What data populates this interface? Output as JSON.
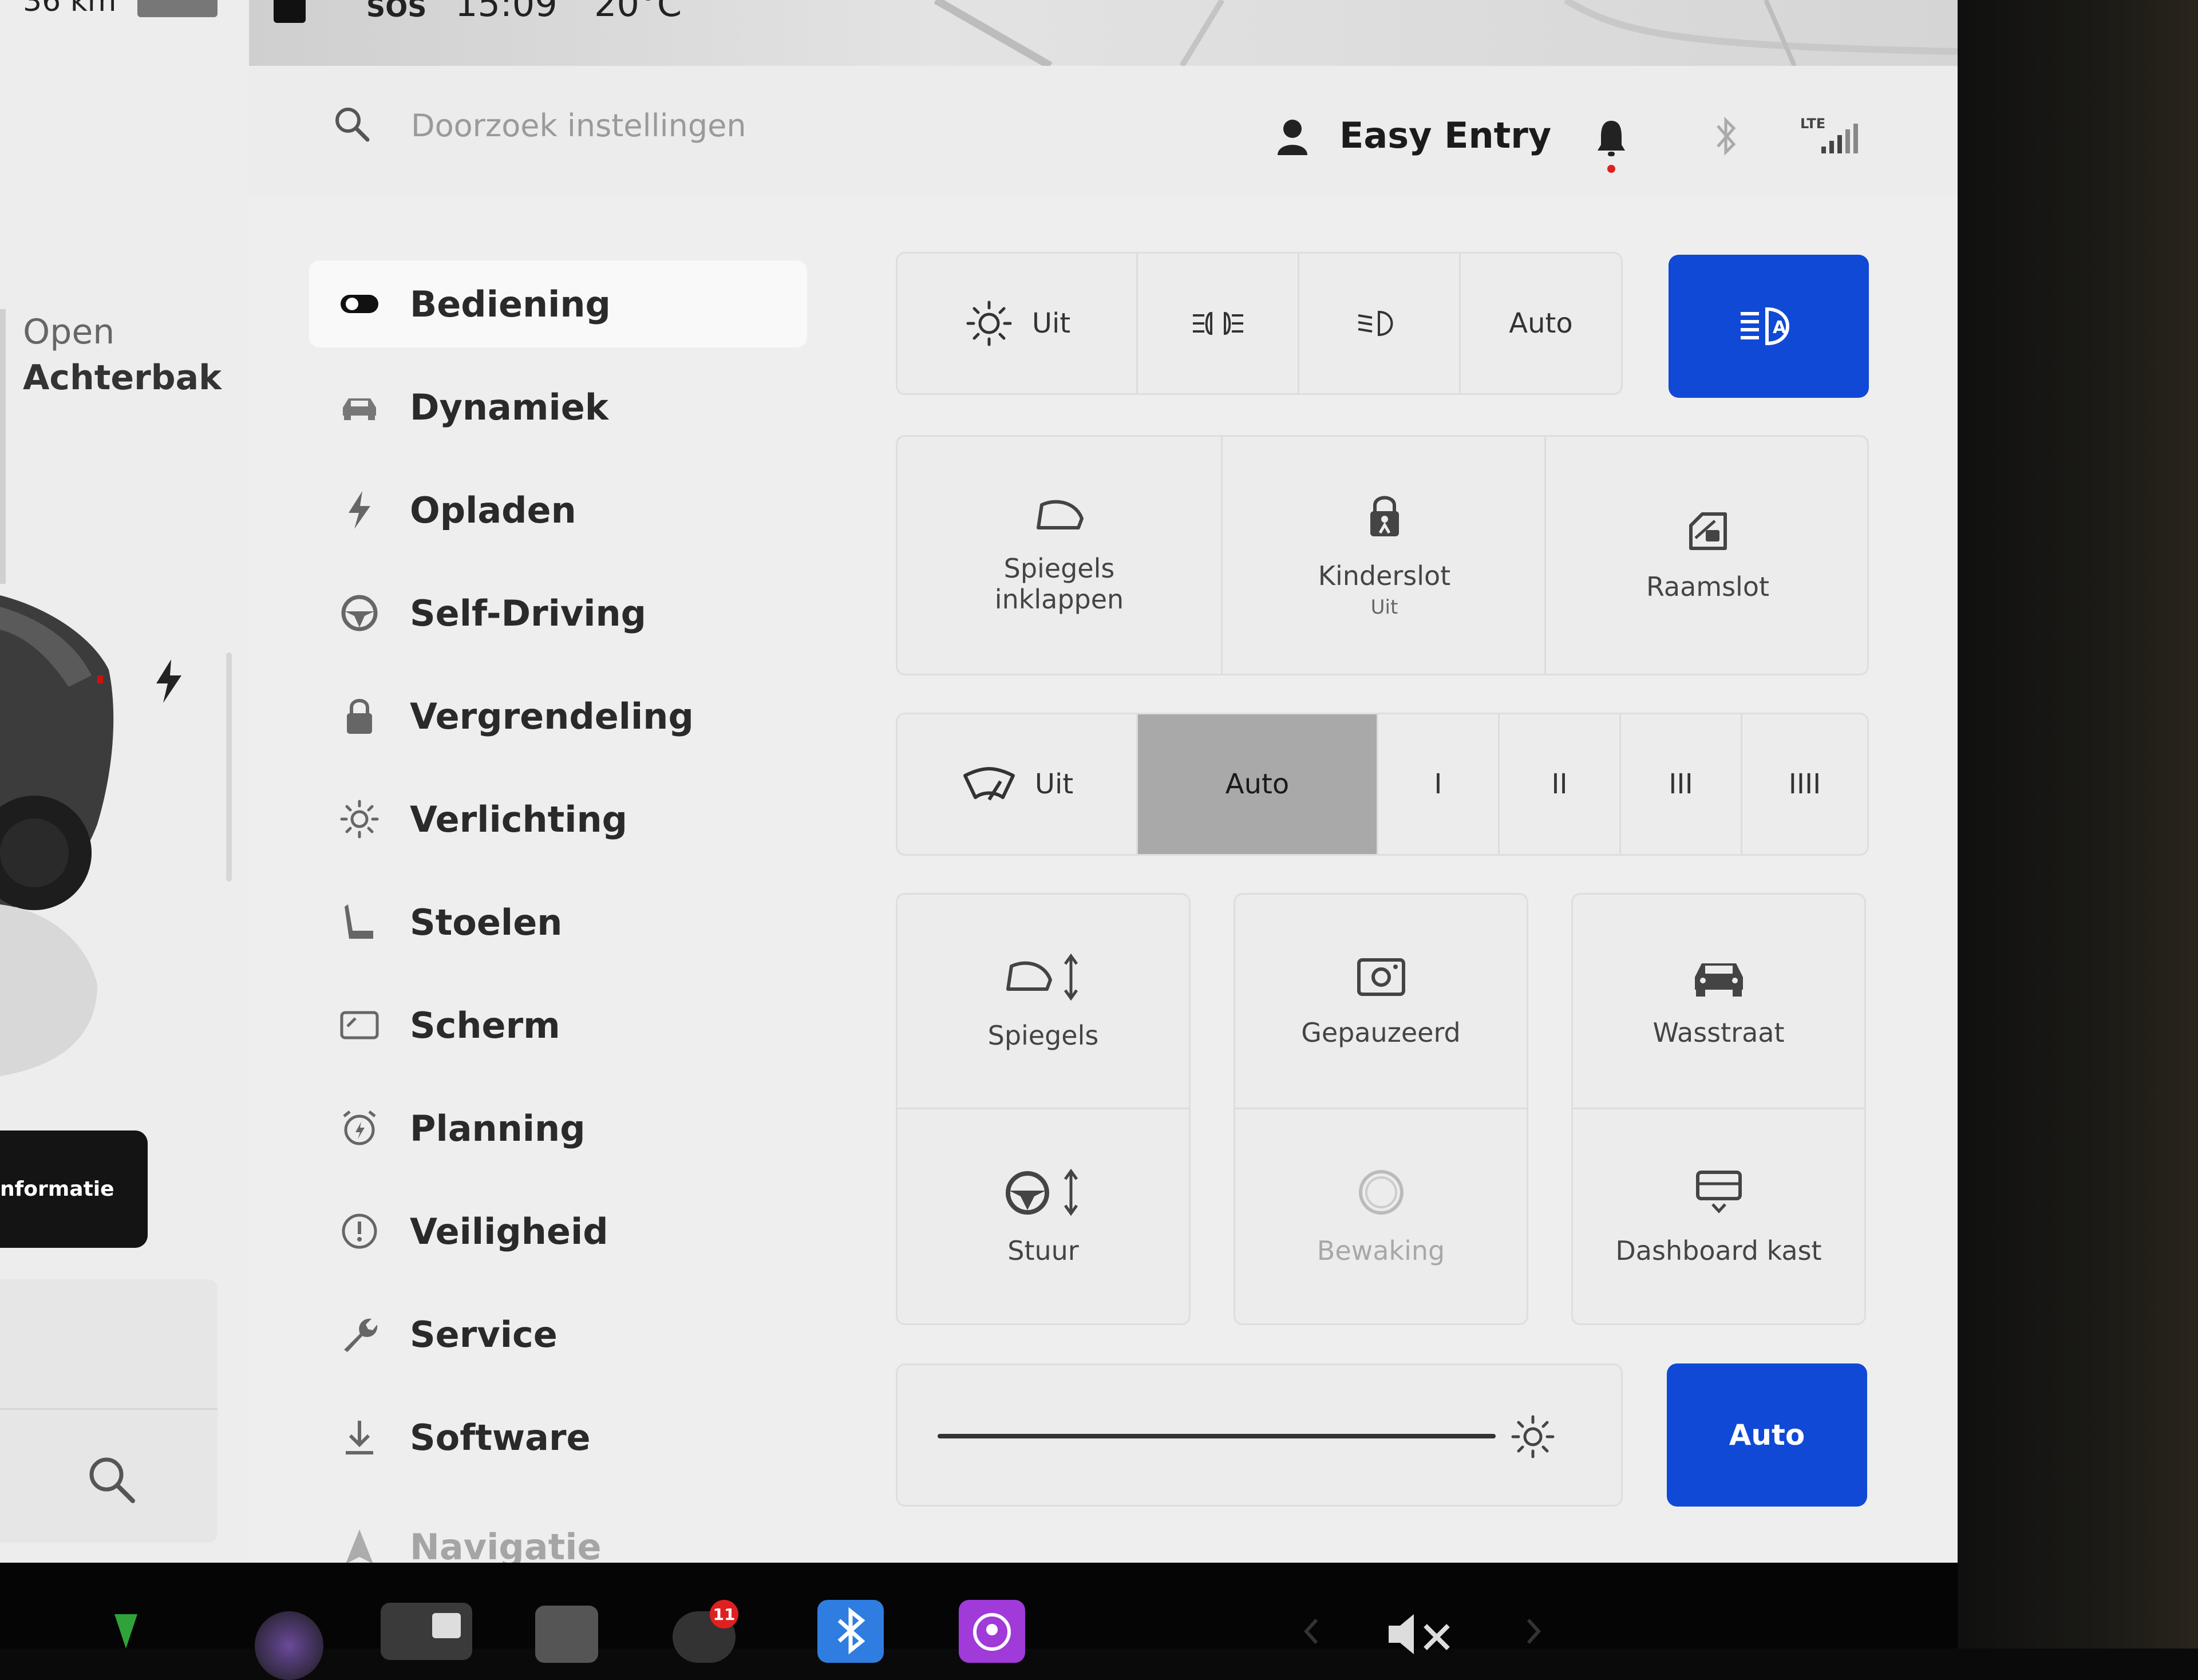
{
  "statusbar": {
    "range": "36 km",
    "sos": "SOS",
    "time": "15:09",
    "temperature": "20°C"
  },
  "car_panel": {
    "trunk_line1": "Open",
    "trunk_line2": "Achterbak",
    "info_button": "nformatie"
  },
  "header": {
    "search_placeholder": "Doorzoek instellingen",
    "profile_name": "Easy Entry",
    "lte": "LTE"
  },
  "sidebar": {
    "items": [
      {
        "label": "Bediening",
        "icon": "toggle-icon",
        "active": true
      },
      {
        "label": "Dynamiek",
        "icon": "car-icon"
      },
      {
        "label": "Opladen",
        "icon": "bolt-icon"
      },
      {
        "label": "Self-Driving",
        "icon": "steering-wheel-icon"
      },
      {
        "label": "Vergrendeling",
        "icon": "lock-icon"
      },
      {
        "label": "Verlichting",
        "icon": "sun-icon"
      },
      {
        "label": "Stoelen",
        "icon": "seat-icon"
      },
      {
        "label": "Scherm",
        "icon": "display-icon"
      },
      {
        "label": "Planning",
        "icon": "alarm-icon"
      },
      {
        "label": "Veiligheid",
        "icon": "alert-icon"
      },
      {
        "label": "Service",
        "icon": "wrench-icon"
      },
      {
        "label": "Software",
        "icon": "download-icon"
      },
      {
        "label": "Navigatie",
        "icon": "navigation-icon"
      }
    ]
  },
  "lights": {
    "off_label": "Uit",
    "auto_label": "Auto",
    "selected": "Auto"
  },
  "quick_controls": {
    "mirrors_fold_line1": "Spiegels",
    "mirrors_fold_line2": "inklappen",
    "child_lock": "Kinderslot",
    "child_lock_state": "Uit",
    "window_lock": "Raamslot"
  },
  "wipers": {
    "off_label": "Uit",
    "auto_label": "Auto",
    "speeds": [
      "I",
      "II",
      "III",
      "IIII"
    ],
    "selected": "Auto"
  },
  "tiles": {
    "mirrors": "Spiegels",
    "dashcam": "Gepauzeerd",
    "car_wash": "Wasstraat",
    "steering": "Stuur",
    "sentry": "Bewaking",
    "glovebox": "Dashboard kast"
  },
  "brightness": {
    "auto_label": "Auto",
    "level": 1.0
  },
  "dock": {
    "notification_count": "11"
  },
  "colors": {
    "accent_blue": "#1049d6",
    "selected_gray": "#a9a9a9",
    "notification_red": "#e02020"
  }
}
